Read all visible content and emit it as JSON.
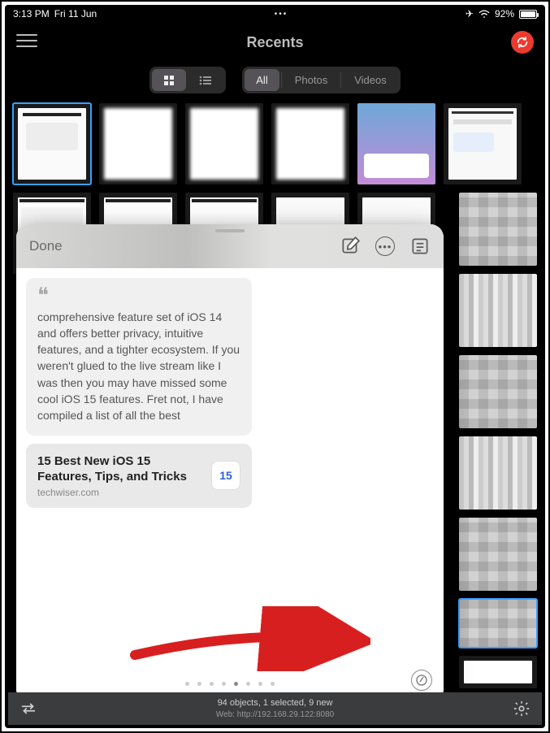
{
  "status": {
    "time": "3:13 PM",
    "date": "Fri 11 Jun",
    "battery_pct": "92%"
  },
  "nav": {
    "title": "Recents"
  },
  "segments": {
    "filter": {
      "all": "All",
      "photos": "Photos",
      "videos": "Videos"
    }
  },
  "modal": {
    "done": "Done",
    "note_text": "comprehensive feature set of iOS 14 and offers better privacy, intuitive features, and a tighter ecosystem. If you weren't glued to the live stream like I was then you may have missed some cool iOS 15 features. Fret not, I have compiled a list of all the best",
    "link_title": "15 Best New iOS 15 Features, Tips, and Tricks",
    "link_source": "techwiser.com",
    "link_badge": "15"
  },
  "bottom": {
    "line1": "94 objects, 1 selected, 9 new",
    "line2": "Web: http://192.168.29.122:8080"
  }
}
